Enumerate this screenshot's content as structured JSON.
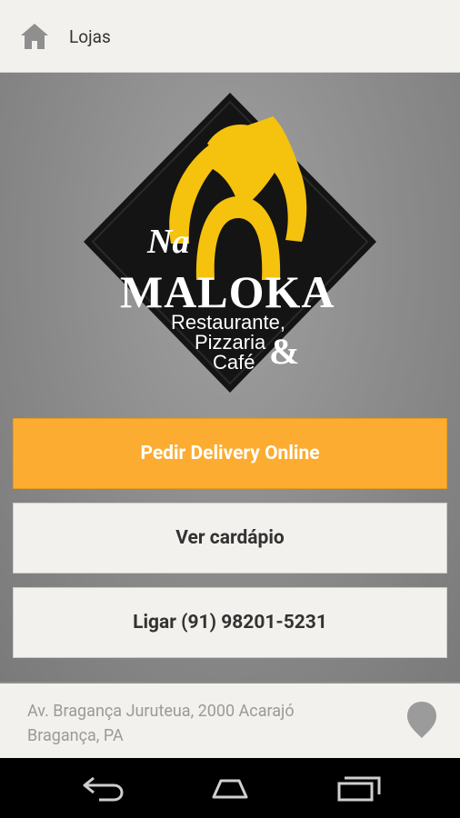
{
  "topbar": {
    "title": "Lojas",
    "home_icon": "home-icon"
  },
  "logo": {
    "line1": "Na",
    "line2": "MALOKA",
    "line3": "Restaurante,",
    "line4": "Pizzaria",
    "line5": "Café",
    "ampersand": "&"
  },
  "actions": {
    "delivery": "Pedir Delivery Online",
    "menu": "Ver cardápio",
    "call": "Ligar (91) 98201-5231"
  },
  "footer": {
    "address_line1": "Av. Bragança Juruteua, 2000 Acarajó",
    "address_line2": "Bragança, PA",
    "pin_icon": "map-pin-icon"
  },
  "nav": {
    "back_icon": "back-icon",
    "home_icon": "nav-home-icon",
    "recents_icon": "recents-icon"
  },
  "colors": {
    "accent": "#fcac30",
    "bar": "#f3f1ed",
    "text": "#333333"
  }
}
